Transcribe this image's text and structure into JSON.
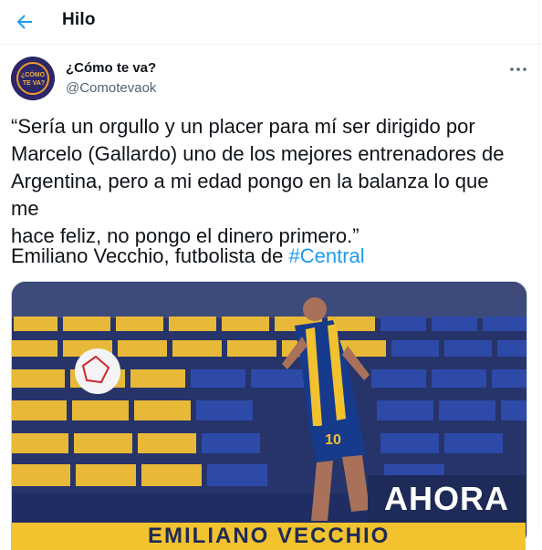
{
  "header": {
    "title": "Hilo",
    "back_icon": "arrow-left-icon",
    "accent": "#1d9bf0"
  },
  "tweet": {
    "display_name": "¿Cómo te va?",
    "handle": "@Comotevaok",
    "avatar_text_line1": "¿CÓMO",
    "avatar_text_line2": "TE VA?",
    "more_icon": "more-icon",
    "text_lines": [
      "“Sería un orgullo y un placer para mí ser dirigido por",
      "Marcelo (Gallardo) uno de los mejores entrenadores de",
      "Argentina, pero a mi edad pongo en la balanza lo que me",
      "hace feliz, no pongo el dinero primero.”"
    ],
    "attribution_prefix": "Emiliano Vecchio, futbolista de ",
    "hashtag": "#Central"
  },
  "media": {
    "badge": "AHORA",
    "caption": "EMILIANO VECCHIO",
    "jersey_number": "10"
  }
}
